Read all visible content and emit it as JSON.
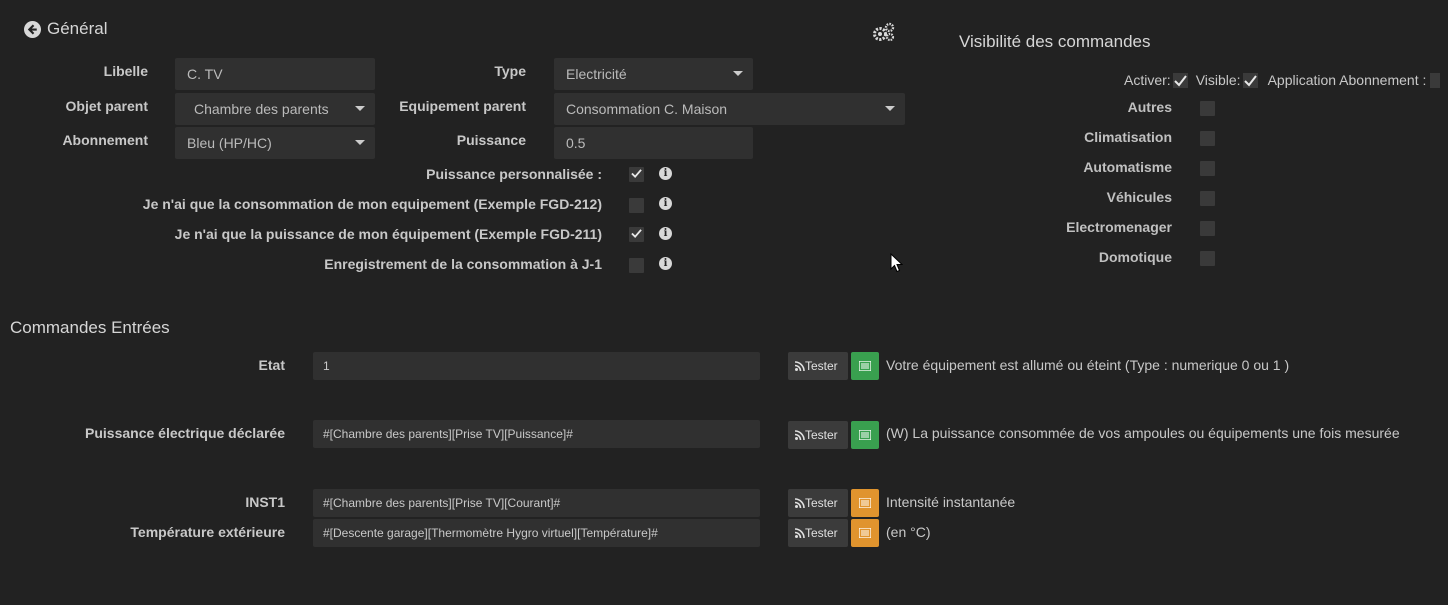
{
  "header": {
    "back_label": "Général",
    "visibility_title": "Visibilité des commandes"
  },
  "form": {
    "libelle_label": "Libelle",
    "libelle_value": "C. TV",
    "type_label": "Type",
    "type_value": "Electricité",
    "objet_parent_label": "Objet parent",
    "objet_parent_value": "Chambre des parents",
    "equipement_parent_label": "Equipement parent",
    "equipement_parent_value": "Consommation C. Maison",
    "abonnement_label": "Abonnement",
    "abonnement_value": "Bleu (HP/HC)",
    "puissance_label": "Puissance",
    "puissance_value": "0.5"
  },
  "options": [
    {
      "label": "Puissance personnalisée :",
      "checked": true
    },
    {
      "label": "Je n'ai que la consommation de mon equipement (Exemple FGD-212)",
      "checked": false
    },
    {
      "label": "Je n'ai que la puissance de mon équipement (Exemple FGD-211)",
      "checked": true
    },
    {
      "label": "Enregistrement de la consommation à J-1",
      "checked": false
    }
  ],
  "visibility": {
    "activer_label": "Activer:",
    "activer_checked": true,
    "visible_label": "Visible:",
    "visible_checked": true,
    "application_label": "Application Abonnement :",
    "categories": [
      {
        "label": "Autres",
        "checked": false
      },
      {
        "label": "Climatisation",
        "checked": false
      },
      {
        "label": "Automatisme",
        "checked": false
      },
      {
        "label": "Véhicules",
        "checked": false
      },
      {
        "label": "Electromenager",
        "checked": false
      },
      {
        "label": "Domotique",
        "checked": false
      }
    ]
  },
  "commands": {
    "title": "Commandes Entrées",
    "tester_label": "Tester",
    "rows": [
      {
        "label": "Etat",
        "value": "1",
        "description": "Votre équipement est allumé ou éteint (Type : numerique 0 ou 1 )",
        "color": "#39a04f"
      },
      {
        "label": "Puissance électrique déclarée",
        "value": "#[Chambre des parents][Prise TV][Puissance]#",
        "description": "(W) La puissance consommée de vos ampoules ou équipements une fois mesurée",
        "color": "#39a04f"
      },
      {
        "label": "INST1",
        "value": "#[Chambre des parents][Prise TV][Courant]#",
        "description": "Intensité instantanée",
        "color": "#e0942e"
      },
      {
        "label": "Température extérieure",
        "value": "#[Descente garage][Thermomètre Hygro virtuel][Température]#",
        "description": "(en °C)",
        "color": "#e0942e"
      }
    ]
  },
  "icons": {
    "back": "arrow-left-circle-icon",
    "settings": "gears-icon",
    "rss": "rss-icon",
    "list": "list-icon",
    "info": "info-icon",
    "cursor": "mouse-cursor-icon"
  }
}
